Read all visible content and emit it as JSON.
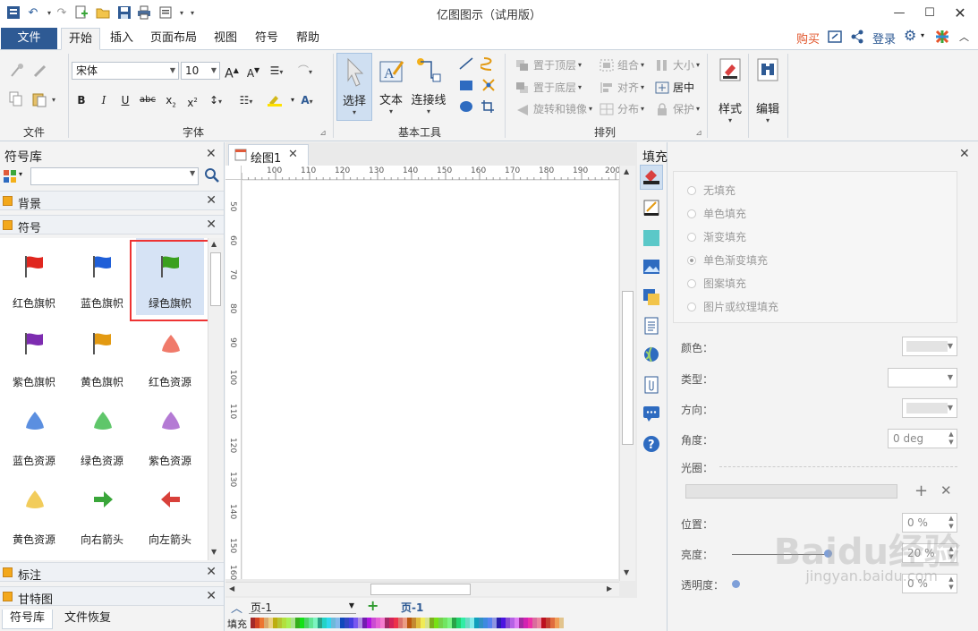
{
  "app": {
    "title": "亿图图示（试用版）"
  },
  "tabs": {
    "file": "文件",
    "items": [
      "开始",
      "插入",
      "页面布局",
      "视图",
      "符号",
      "帮助"
    ]
  },
  "topright": {
    "buy": "购买",
    "login": "登录"
  },
  "ribbon": {
    "groups": {
      "file": "文件",
      "font": "字体",
      "tools": "基本工具",
      "arrange": "排列"
    },
    "font_name": "宋体",
    "font_size": "10",
    "tools": {
      "select": "选择",
      "text": "文本",
      "connector": "连接线"
    },
    "arrange": {
      "bring_front": "置于顶层",
      "group": "组合",
      "size": "大小",
      "send_back": "置于底层",
      "align": "对齐",
      "center": "居中",
      "rotate": "旋转和镜像",
      "distribute": "分布",
      "protect": "保护"
    },
    "style": "样式",
    "edit": "编辑"
  },
  "library": {
    "title": "符号库",
    "search_placeholder": "",
    "sections": {
      "background": "背景",
      "symbols": "符号",
      "annotation": "标注",
      "gantt": "甘特图"
    },
    "symbols": [
      {
        "label": "红色旗帜",
        "color": "#e0271f"
      },
      {
        "label": "蓝色旗帜",
        "color": "#1f5fd8"
      },
      {
        "label": "绿色旗帜",
        "color": "#3aa01f"
      },
      {
        "label": "紫色旗帜",
        "color": "#7d2cb0"
      },
      {
        "label": "黄色旗帜",
        "color": "#e39a12"
      },
      {
        "label": "红色资源",
        "color": "#f07a6a"
      },
      {
        "label": "蓝色资源",
        "color": "#5b8fe0"
      },
      {
        "label": "绿色资源",
        "color": "#5fc66a"
      },
      {
        "label": "紫色资源",
        "color": "#b47ad4"
      },
      {
        "label": "黄色资源",
        "color": "#f2cc5b"
      },
      {
        "label": "向右箭头",
        "color": "#3aa63a"
      },
      {
        "label": "向左箭头",
        "color": "#d8403a"
      }
    ],
    "bottom_tabs": [
      "符号库",
      "文件恢复"
    ]
  },
  "document": {
    "tab": "绘图1",
    "h_ticks": [
      "100",
      "110",
      "120",
      "130",
      "140",
      "150",
      "160",
      "170",
      "180",
      "190",
      "200"
    ],
    "v_ticks": [
      "50",
      "60",
      "70",
      "80",
      "90",
      "100",
      "110",
      "120",
      "130",
      "140",
      "150",
      "160"
    ],
    "page_select": "页-1",
    "page_tab": "页-1",
    "fill_label": "填充"
  },
  "fill": {
    "title": "填充",
    "options": [
      "无填充",
      "单色填充",
      "渐变填充",
      "单色渐变填充",
      "图案填充",
      "图片或纹理填充"
    ],
    "selected_option": "单色渐变填充",
    "props": {
      "color": "颜色：",
      "type": "类型：",
      "direction": "方向：",
      "angle": "角度：",
      "angle_value": "0 deg",
      "aperture": "光圈：",
      "position": "位置：",
      "position_value": "0 %",
      "brightness": "亮度：",
      "brightness_value": "20 %",
      "transparency": "透明度：",
      "transparency_value": "0 %"
    }
  },
  "watermark": {
    "main": "Baidu经验",
    "sub": "jingyan.baidu.com"
  }
}
